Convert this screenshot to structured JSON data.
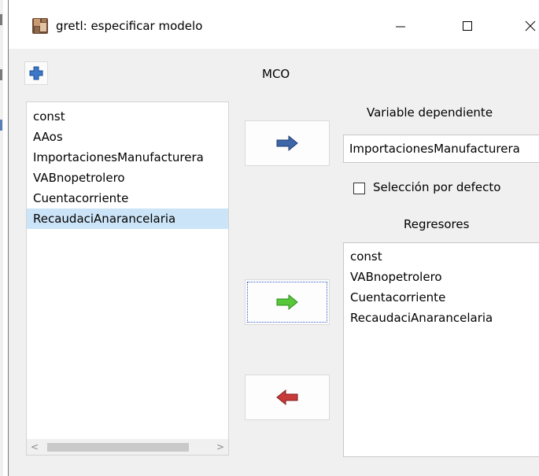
{
  "window": {
    "title": "gretl: especificar modelo",
    "icon": "gretl-app-icon",
    "controls": {
      "minimize": "minimize-icon",
      "maximize": "maximize-icon",
      "close": "close-icon"
    }
  },
  "toolbar": {
    "add_icon": "plus-icon"
  },
  "method_label": "MCO",
  "available_variables": {
    "items": [
      "const",
      "AAos",
      "ImportacionesManufacturera",
      "VABnopetrolero",
      "Cuentacorriente",
      "RecaudaciAnarancelaria"
    ],
    "selected_index": 5
  },
  "transfer_buttons": {
    "dependent": {
      "icon": "arrow-right-blue-icon",
      "color": "#2b4f86"
    },
    "add_regressor": {
      "icon": "arrow-right-green-icon",
      "color": "#3fae2a"
    },
    "remove_regressor": {
      "icon": "arrow-left-red-icon",
      "color": "#b22a2a"
    }
  },
  "dependent": {
    "label": "Variable dependiente",
    "value": "ImportacionesManufacturera"
  },
  "default_selection": {
    "label": "Selección por defecto",
    "checked": false
  },
  "regressors": {
    "label": "Regresores",
    "items": [
      "const",
      "VABnopetrolero",
      "Cuentacorriente",
      "RecaudaciAnarancelaria"
    ]
  }
}
